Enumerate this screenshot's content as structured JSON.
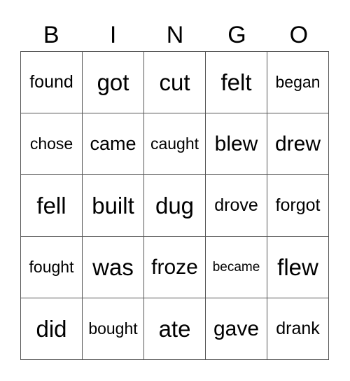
{
  "header": {
    "letters": [
      "B",
      "I",
      "N",
      "G",
      "O"
    ]
  },
  "board": {
    "rows": [
      [
        "found",
        "got",
        "cut",
        "felt",
        "began"
      ],
      [
        "chose",
        "came",
        "caught",
        "blew",
        "drew"
      ],
      [
        "fell",
        "built",
        "dug",
        "drove",
        "forgot"
      ],
      [
        "fought",
        "was",
        "froze",
        "became",
        "flew"
      ],
      [
        "did",
        "bought",
        "ate",
        "gave",
        "drank"
      ]
    ]
  }
}
